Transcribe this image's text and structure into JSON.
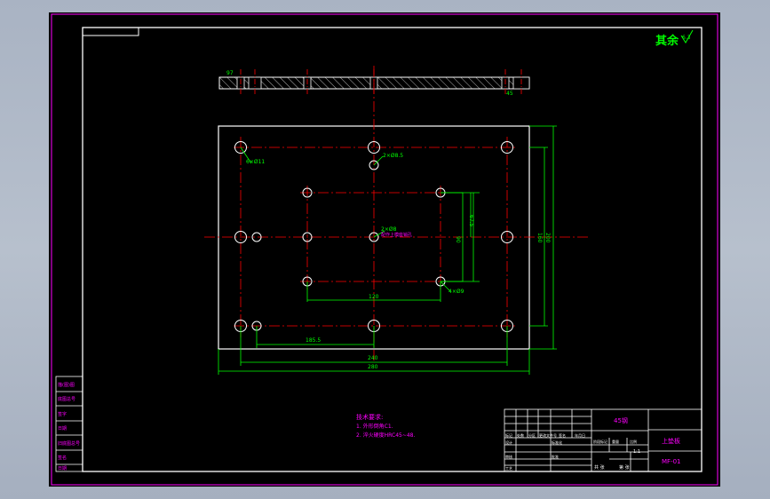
{
  "colors": {
    "background": "#000000",
    "frame": "#ff00ff",
    "geometry": "#ffffff",
    "centerline": "#ff0000",
    "dimension": "#00ff00",
    "text": "#ff00ff",
    "hatch": "#ffffff",
    "surround": "#a9b3c3"
  },
  "roughness": "其余",
  "roughness_value": "6.3",
  "section": {
    "thickness_label": "97",
    "right_label": "45"
  },
  "plan": {
    "hole_callout_top": "2×Ø8.5",
    "hole_callout_corner": "6×Ø11",
    "center_callout_1": "2×Ø8",
    "center_callout_2": "配作上模座销孔",
    "pattern_callout": "4×Ø9",
    "dim_inner_v": "67.5",
    "dim_middle_v": "90",
    "dim_outer_v1": "160",
    "dim_outer_v2": "200",
    "dim_inner_h": "120",
    "dim_small_h": "185.5",
    "dim_mid_h": "240",
    "dim_outer_h": "280"
  },
  "notes": {
    "heading": "技术要求:",
    "line1": "1. 外形倒角C1.",
    "line2": "2. 淬火硬度HRC45~48."
  },
  "side_table": [
    "描(图)图",
    "底图总号",
    "签字",
    "日期",
    "旧底图总号",
    "签名",
    "日期"
  ],
  "title_block": {
    "material": "45钢",
    "part_name": "上垫板",
    "drawing_no": "MF-01",
    "scale": "1:1",
    "row_labels": [
      "标记",
      "处数",
      "分区",
      "更改文件号",
      "签名",
      "年月日"
    ],
    "roles": [
      "设计",
      "审核",
      "工艺"
    ],
    "cols": [
      "标准化",
      "批准",
      "阶段标记",
      "重量",
      "比例"
    ],
    "bottom": [
      "共 张",
      "第 张"
    ]
  }
}
